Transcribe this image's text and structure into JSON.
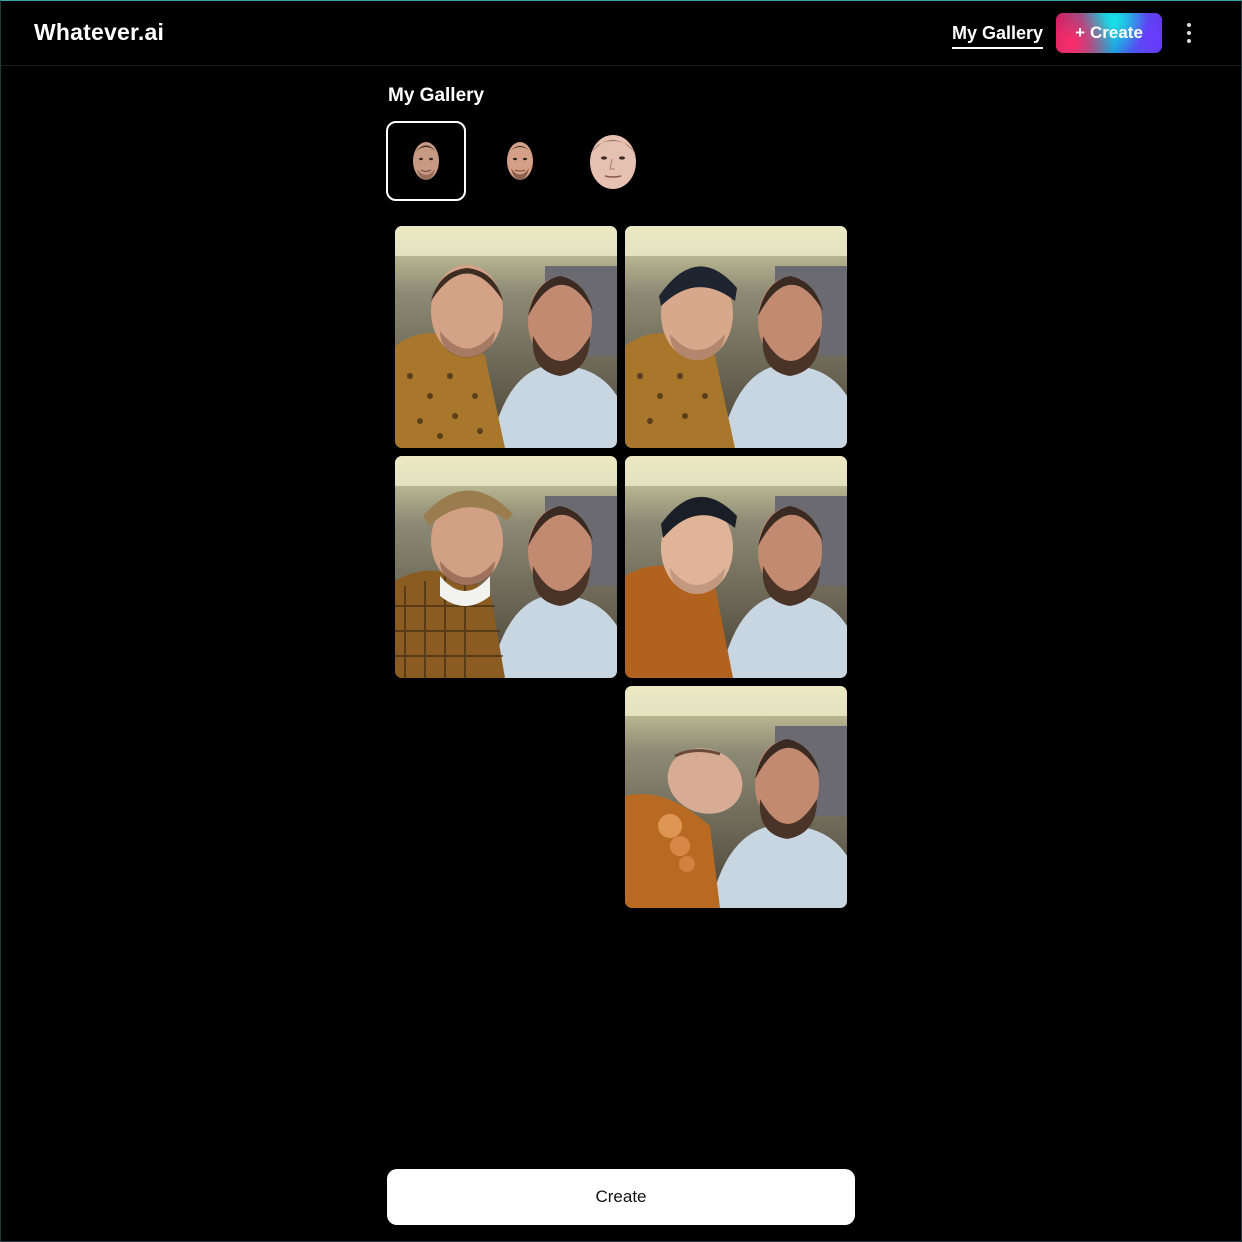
{
  "app": {
    "logo": "Whatever.ai"
  },
  "nav": {
    "gallery_label": "My Gallery",
    "create_label": "Create",
    "create_plus": "+",
    "more_icon": "kebab-vertical-icon"
  },
  "gallery": {
    "title": "My Gallery",
    "faces": [
      {
        "name": "face-1",
        "selected": true
      },
      {
        "name": "face-2",
        "selected": false
      },
      {
        "name": "face-3",
        "selected": false
      }
    ],
    "photos": [
      {
        "name": "photo-1",
        "hat": "none",
        "jacket": "leopard"
      },
      {
        "name": "photo-2",
        "hat": "beanie",
        "jacket": "leopard"
      },
      {
        "name": "photo-3",
        "hat": "cap",
        "jacket": "plaid"
      },
      {
        "name": "photo-4",
        "hat": "beanie",
        "jacket": "orange"
      },
      {
        "name": "photo-5",
        "hat": "none",
        "jacket": "orange"
      }
    ]
  },
  "footer": {
    "create_button": "Create"
  },
  "colors": {
    "background": "#000000",
    "accent_pink": "#ff2b6b",
    "accent_cyan": "#19e3e6",
    "accent_purple": "#6a3cff"
  }
}
